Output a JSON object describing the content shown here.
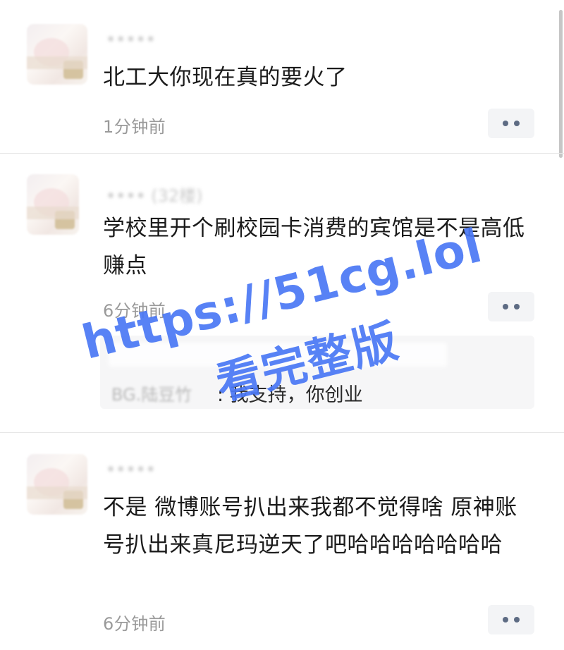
{
  "comments": [
    {
      "nickname": "•••••",
      "text": "北工大你现在真的要火了",
      "time": "1分钟前"
    },
    {
      "nickname": "•••• (32楼)",
      "text": "学校里开个刷校园卡消费的宾馆是不是高低赚点",
      "time": "6分钟前",
      "reply": {
        "author": "BG.陆豆竹",
        "text": ": 我支持，你创业"
      }
    },
    {
      "nickname": "•••••",
      "text": "不是 微博账号扒出来我都不觉得啥 原神账号扒出来真尼玛逆天了吧哈哈哈哈哈哈哈",
      "time": "6分钟前"
    }
  ],
  "watermark": {
    "url": "https://51cg.lol",
    "title": "看完整版"
  },
  "colors": {
    "watermark": "#4a78f5",
    "time_text": "#9a9a9a",
    "more_button_bg": "#f3f4f6",
    "more_button_dots": "#5d6b83"
  }
}
